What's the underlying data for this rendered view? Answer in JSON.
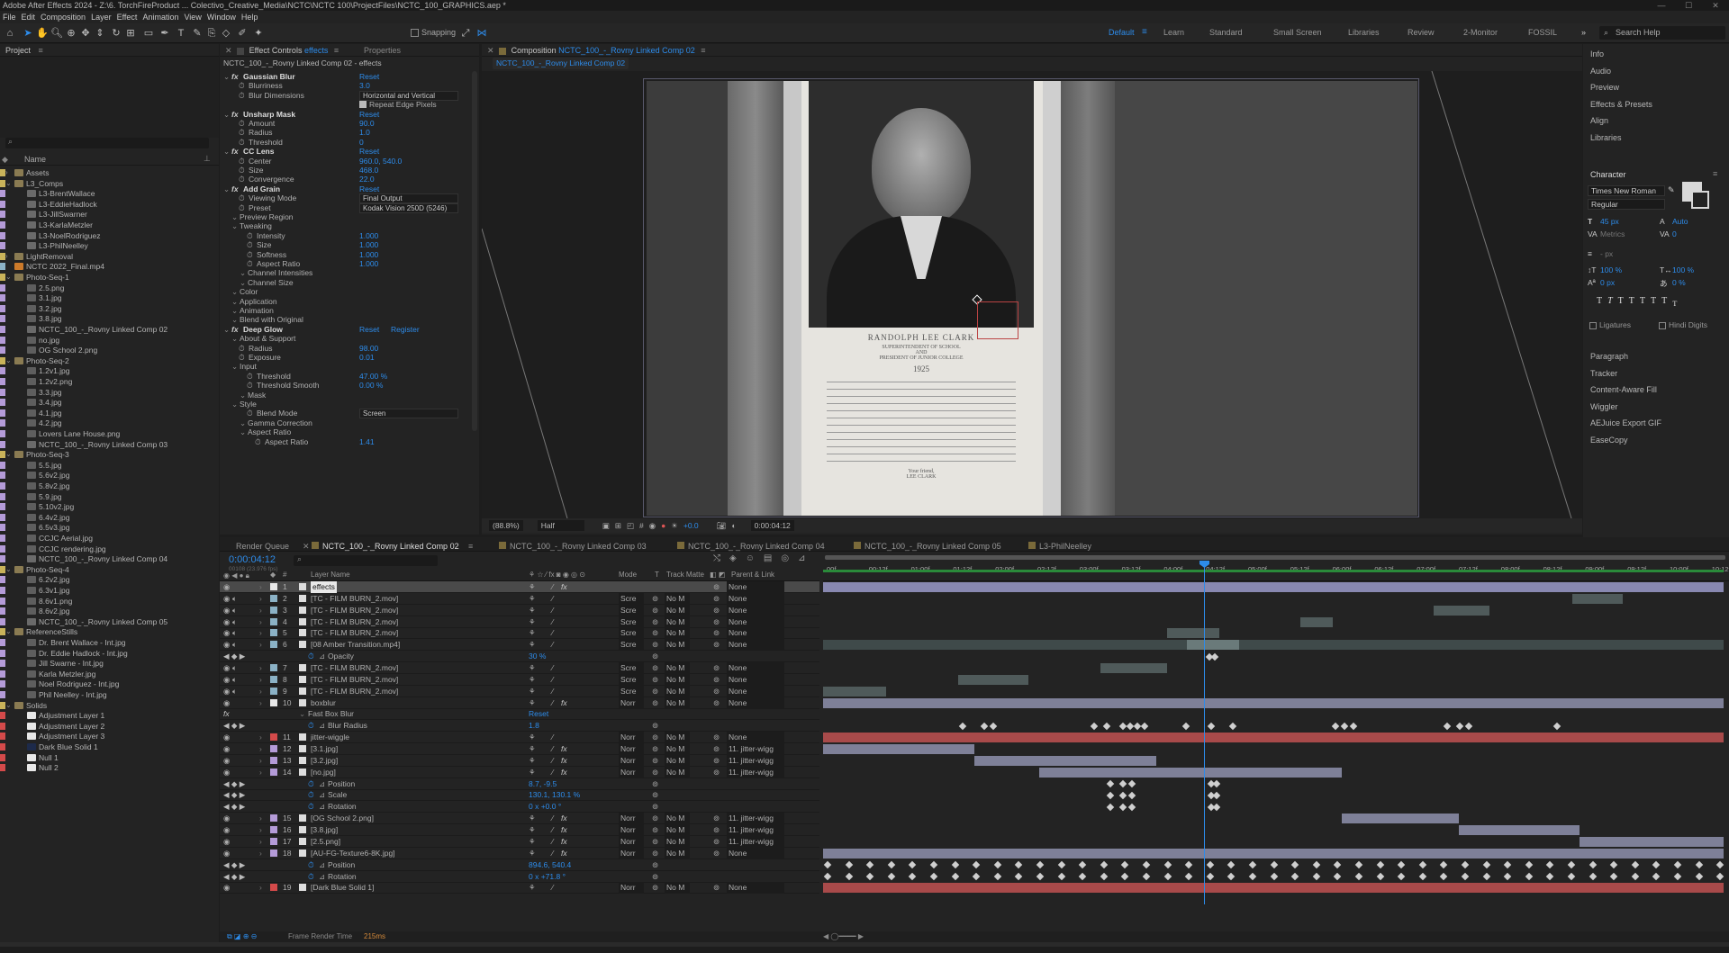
{
  "app": {
    "title": "Adobe After Effects 2024 - Z:\\6. TorchFireProduct ... Colectivo_Creative_Media\\NCTC\\NCTC 100\\ProjectFiles\\NCTC_100_GRAPHICS.aep *"
  },
  "menu": [
    "File",
    "Edit",
    "Composition",
    "Layer",
    "Effect",
    "Animation",
    "View",
    "Window",
    "Help"
  ],
  "toolbar": {
    "snapping": "Snapping",
    "workspaces": [
      "Default",
      "Learn",
      "Standard",
      "Small Screen",
      "Libraries",
      "Review",
      "2-Monitor",
      "FOSSIL"
    ],
    "search_help": "Search Help"
  },
  "project": {
    "title": "Project",
    "column_name": "Name",
    "rows": [
      {
        "name": "Assets",
        "type": "folder",
        "indent": 1,
        "label": "#c9b35a"
      },
      {
        "name": "L3_Comps",
        "type": "folder",
        "indent": 1,
        "open": true,
        "label": "#c9b35a"
      },
      {
        "name": "L3-BrentWallace",
        "type": "comp",
        "indent": 3,
        "label": "#b49bd8"
      },
      {
        "name": "L3-EddieHadlock",
        "type": "comp",
        "indent": 3,
        "label": "#b49bd8"
      },
      {
        "name": "L3-JillSwarner",
        "type": "comp",
        "indent": 3,
        "label": "#b49bd8"
      },
      {
        "name": "L3-KarlaMetzler",
        "type": "comp",
        "indent": 3,
        "label": "#b49bd8"
      },
      {
        "name": "L3-NoelRodriguez",
        "type": "comp",
        "indent": 3,
        "label": "#b49bd8"
      },
      {
        "name": "L3-PhilNeelley",
        "type": "comp",
        "indent": 3,
        "label": "#b49bd8"
      },
      {
        "name": "LightRemoval",
        "type": "folder",
        "indent": 1,
        "label": "#c9b35a"
      },
      {
        "name": "NCTC 2022_Final.mp4",
        "type": "video",
        "indent": 1,
        "label": "#8bb2c6"
      },
      {
        "name": "Photo-Seq-1",
        "type": "folder",
        "indent": 1,
        "open": true,
        "label": "#c9b35a"
      },
      {
        "name": "2.5.png",
        "type": "image",
        "indent": 3,
        "label": "#b49bd8"
      },
      {
        "name": "3.1.jpg",
        "type": "image",
        "indent": 3,
        "label": "#b49bd8"
      },
      {
        "name": "3.2.jpg",
        "type": "image",
        "indent": 3,
        "label": "#b49bd8"
      },
      {
        "name": "3.8.jpg",
        "type": "image",
        "indent": 3,
        "label": "#b49bd8"
      },
      {
        "name": "NCTC_100_-_Rovny Linked Comp 02",
        "type": "comp",
        "indent": 3,
        "label": "#b49bd8"
      },
      {
        "name": "no.jpg",
        "type": "image",
        "indent": 3,
        "label": "#b49bd8"
      },
      {
        "name": "OG School 2.png",
        "type": "image",
        "indent": 3,
        "label": "#b49bd8"
      },
      {
        "name": "Photo-Seq-2",
        "type": "folder",
        "indent": 1,
        "open": true,
        "label": "#c9b35a"
      },
      {
        "name": "1.2v1.jpg",
        "type": "image",
        "indent": 3,
        "label": "#b49bd8"
      },
      {
        "name": "1.2v2.png",
        "type": "image",
        "indent": 3,
        "label": "#b49bd8"
      },
      {
        "name": "3.3.jpg",
        "type": "image",
        "indent": 3,
        "label": "#b49bd8"
      },
      {
        "name": "3.4.jpg",
        "type": "image",
        "indent": 3,
        "label": "#b49bd8"
      },
      {
        "name": "4.1.jpg",
        "type": "image",
        "indent": 3,
        "label": "#b49bd8"
      },
      {
        "name": "4.2.jpg",
        "type": "image",
        "indent": 3,
        "label": "#b49bd8"
      },
      {
        "name": "Lovers Lane House.png",
        "type": "image",
        "indent": 3,
        "label": "#b49bd8"
      },
      {
        "name": "NCTC_100_-_Rovny Linked Comp 03",
        "type": "comp",
        "indent": 3,
        "label": "#b49bd8"
      },
      {
        "name": "Photo-Seq-3",
        "type": "folder",
        "indent": 1,
        "open": true,
        "label": "#c9b35a"
      },
      {
        "name": "5.5.jpg",
        "type": "image",
        "indent": 3,
        "label": "#b49bd8"
      },
      {
        "name": "5.6v2.jpg",
        "type": "image",
        "indent": 3,
        "label": "#b49bd8"
      },
      {
        "name": "5.8v2.jpg",
        "type": "image",
        "indent": 3,
        "label": "#b49bd8"
      },
      {
        "name": "5.9.jpg",
        "type": "image",
        "indent": 3,
        "label": "#b49bd8"
      },
      {
        "name": "5.10v2.jpg",
        "type": "image",
        "indent": 3,
        "label": "#b49bd8"
      },
      {
        "name": "6.4v2.jpg",
        "type": "image",
        "indent": 3,
        "label": "#b49bd8"
      },
      {
        "name": "6.5v3.jpg",
        "type": "image",
        "indent": 3,
        "label": "#b49bd8"
      },
      {
        "name": "CCJC Aerial.jpg",
        "type": "image",
        "indent": 3,
        "label": "#b49bd8"
      },
      {
        "name": "CCJC rendering.jpg",
        "type": "image",
        "indent": 3,
        "label": "#b49bd8"
      },
      {
        "name": "NCTC_100_-_Rovny Linked Comp 04",
        "type": "comp",
        "indent": 3,
        "label": "#b49bd8"
      },
      {
        "name": "Photo-Seq-4",
        "type": "folder",
        "indent": 1,
        "open": true,
        "label": "#c9b35a"
      },
      {
        "name": "6.2v2.jpg",
        "type": "image",
        "indent": 3,
        "label": "#b49bd8"
      },
      {
        "name": "6.3v1.jpg",
        "type": "image",
        "indent": 3,
        "label": "#b49bd8"
      },
      {
        "name": "8.6v1.png",
        "type": "image",
        "indent": 3,
        "label": "#b49bd8"
      },
      {
        "name": "8.6v2.jpg",
        "type": "image",
        "indent": 3,
        "label": "#b49bd8"
      },
      {
        "name": "NCTC_100_-_Rovny Linked Comp 05",
        "type": "comp",
        "indent": 3,
        "label": "#b49bd8"
      },
      {
        "name": "ReferenceStills",
        "type": "folder",
        "indent": 1,
        "open": true,
        "label": "#c9b35a"
      },
      {
        "name": "Dr. Brent Wallace - Int.jpg",
        "type": "image",
        "indent": 3,
        "label": "#b49bd8"
      },
      {
        "name": "Dr. Eddie Hadlock - Int.jpg",
        "type": "image",
        "indent": 3,
        "label": "#b49bd8"
      },
      {
        "name": "Jill Swarne - Int.jpg",
        "type": "image",
        "indent": 3,
        "label": "#b49bd8"
      },
      {
        "name": "Karla Metzler.jpg",
        "type": "image",
        "indent": 3,
        "label": "#b49bd8"
      },
      {
        "name": "Noel Rodriguez - Int.jpg",
        "type": "image",
        "indent": 3,
        "label": "#b49bd8"
      },
      {
        "name": "Phil Neelley - Int.jpg",
        "type": "image",
        "indent": 3,
        "label": "#b49bd8"
      },
      {
        "name": "Solids",
        "type": "folder",
        "indent": 1,
        "open": true,
        "label": "#c9b35a"
      },
      {
        "name": "Adjustment Layer 1",
        "type": "solid",
        "indent": 3,
        "label": "#d44a4a"
      },
      {
        "name": "Adjustment Layer 2",
        "type": "solid",
        "indent": 3,
        "label": "#d44a4a"
      },
      {
        "name": "Adjustment Layer 3",
        "type": "solid",
        "indent": 3,
        "label": "#d44a4a"
      },
      {
        "name": "Dark Blue Solid 1",
        "type": "solid-dark",
        "indent": 3,
        "label": "#d44a4a"
      },
      {
        "name": "Null 1",
        "type": "solid",
        "indent": 3,
        "label": "#d44a4a"
      },
      {
        "name": "Null 2",
        "type": "solid",
        "indent": 3,
        "label": "#d44a4a"
      }
    ]
  },
  "effect_controls": {
    "tab": "Effect Controls",
    "tab_target": "effects",
    "properties_tab": "Properties",
    "header": "NCTC_100_-_Rovny Linked Comp 02 - effects",
    "rows": [
      {
        "level": 0,
        "name": "Gaussian Blur",
        "fx": true,
        "value": "Reset"
      },
      {
        "level": 1,
        "name": "Blurriness",
        "value": "3.0"
      },
      {
        "level": 1,
        "name": "Blur Dimensions",
        "dropdown": "Horizontal and Vertical"
      },
      {
        "level": 1,
        "name": "",
        "checkbox": "Repeat Edge Pixels"
      },
      {
        "level": 0,
        "name": "Unsharp Mask",
        "fx": true,
        "value": "Reset"
      },
      {
        "level": 1,
        "name": "Amount",
        "value": "90.0"
      },
      {
        "level": 1,
        "name": "Radius",
        "value": "1.0"
      },
      {
        "level": 1,
        "name": "Threshold",
        "value": "0"
      },
      {
        "level": 0,
        "name": "CC Lens",
        "fx": true,
        "value": "Reset"
      },
      {
        "level": 1,
        "name": "Center",
        "value": "960.0, 540.0"
      },
      {
        "level": 1,
        "name": "Size",
        "value": "468.0"
      },
      {
        "level": 1,
        "name": "Convergence",
        "value": "22.0"
      },
      {
        "level": 0,
        "name": "Add Grain",
        "fx": true,
        "value": "Reset"
      },
      {
        "level": 1,
        "name": "Viewing Mode",
        "dropdown": "Final Output"
      },
      {
        "level": 1,
        "name": "Preset",
        "dropdown": "Kodak Vision 250D (5246)"
      },
      {
        "level": 1,
        "name": "Preview Region",
        "group": true
      },
      {
        "level": 1,
        "name": "Tweaking",
        "group": true
      },
      {
        "level": 2,
        "name": "Intensity",
        "value": "1.000"
      },
      {
        "level": 2,
        "name": "Size",
        "value": "1.000"
      },
      {
        "level": 2,
        "name": "Softness",
        "value": "1.000"
      },
      {
        "level": 2,
        "name": "Aspect Ratio",
        "value": "1.000"
      },
      {
        "level": 2,
        "name": "Channel Intensities",
        "group": true
      },
      {
        "level": 2,
        "name": "Channel Size",
        "group": true
      },
      {
        "level": 1,
        "name": "Color",
        "group": true
      },
      {
        "level": 1,
        "name": "Application",
        "group": true
      },
      {
        "level": 1,
        "name": "Animation",
        "group": true
      },
      {
        "level": 1,
        "name": "Blend with Original",
        "group": true
      },
      {
        "level": 0,
        "name": "Deep Glow",
        "fx": true,
        "value": "Reset",
        "value2": "Register"
      },
      {
        "level": 1,
        "name": "About & Support",
        "group": true
      },
      {
        "level": 1,
        "name": "Radius",
        "value": "98.00"
      },
      {
        "level": 1,
        "name": "Exposure",
        "value": "0.01"
      },
      {
        "level": 1,
        "name": "Input",
        "group": true
      },
      {
        "level": 2,
        "name": "Threshold",
        "value": "47.00 %"
      },
      {
        "level": 2,
        "name": "Threshold Smooth",
        "value": "0.00 %"
      },
      {
        "level": 2,
        "name": "Mask",
        "group": true
      },
      {
        "level": 1,
        "name": "Style",
        "group": true
      },
      {
        "level": 2,
        "name": "Blend Mode",
        "dropdown": "Screen"
      },
      {
        "level": 2,
        "name": "Gamma Correction",
        "group": true
      },
      {
        "level": 2,
        "name": "Aspect Ratio",
        "group": true
      },
      {
        "level": 3,
        "name": "Aspect Ratio",
        "value": "1.41"
      }
    ]
  },
  "composition": {
    "tab_prefix": "Composition",
    "tab": "NCTC_100_-_Rovny Linked Comp 02",
    "subtab": "NCTC_100_-_Rovny Linked Comp 02",
    "zoom": "(88.8%)",
    "resolution": "Half",
    "exposure": "+0.0",
    "timecode": "0:00:04:12",
    "photo_text": {
      "name": "RANDOLPH LEE CLARK",
      "line1": "SUPERINTENDENT OF SCHOOL",
      "line2": "AND",
      "line3": "PRESIDENT OF JUNIOR COLLEGE",
      "year": "1925",
      "sign": "Your friend,",
      "sign2": "LEE CLARK"
    }
  },
  "right_panel": {
    "items": [
      "Info",
      "Audio",
      "Preview",
      "Effects & Presets",
      "Align",
      "Libraries"
    ],
    "character": {
      "title": "Character",
      "font": "Times New Roman",
      "style": "Regular",
      "size": "45 px",
      "leading": "Auto",
      "kerning": "Metrics",
      "tracking": "0",
      "stroke": "- px",
      "vscale": "100 %",
      "hscale": "100 %",
      "baseline": "0 px",
      "tsume": "0 %",
      "ligatures": "Ligatures",
      "hindi": "Hindi Digits"
    },
    "items2": [
      "Paragraph",
      "Tracker",
      "Content-Aware Fill",
      "Wiggler",
      "AEJuice Export GIF",
      "EaseCopy"
    ]
  },
  "timeline": {
    "tabs": [
      "Render Queue",
      "NCTC_100_-_Rovny Linked Comp 02",
      "NCTC_100_-_Rovny Linked Comp 03",
      "NCTC_100_-_Rovny Linked Comp 04",
      "NCTC_100_-_Rovny Linked Comp 05",
      "L3-PhilNeelley"
    ],
    "timecode": "0:00:04:12",
    "timecode_sub": "00108 (23.976 fps)",
    "col_layer_name": "Layer Name",
    "col_mode": "Mode",
    "col_t": "T",
    "col_trkmat": "Track Matte",
    "col_parent": "Parent & Link",
    "ruler": [
      "00f",
      "00:12f",
      "01:00f",
      "01:12f",
      "02:00f",
      "02:12f",
      "03:00f",
      "03:12f",
      "04:00f",
      "04:12f",
      "05:00f",
      "05:12f",
      "06:00f",
      "06:12f",
      "07:00f",
      "07:12f",
      "08:00f",
      "08:12f",
      "09:00f",
      "09:12f",
      "10:00f",
      "10:12f"
    ],
    "rows": [
      {
        "kind": "layer",
        "num": "1",
        "name": "effects",
        "label": "#e8e8e8",
        "mode": "",
        "matte": "",
        "parent": "None",
        "fx": true,
        "selected": true
      },
      {
        "kind": "layer",
        "num": "2",
        "name": "[TC - FILM BURN_2.mov]",
        "label": "#8bb2c6",
        "mode": "Scre",
        "matte": "No M",
        "parent": "None"
      },
      {
        "kind": "layer",
        "num": "3",
        "name": "[TC - FILM BURN_2.mov]",
        "label": "#8bb2c6",
        "mode": "Scre",
        "matte": "No M",
        "parent": "None"
      },
      {
        "kind": "layer",
        "num": "4",
        "name": "[TC - FILM BURN_2.mov]",
        "label": "#8bb2c6",
        "mode": "Scre",
        "matte": "No M",
        "parent": "None"
      },
      {
        "kind": "layer",
        "num": "5",
        "name": "[TC - FILM BURN_2.mov]",
        "label": "#8bb2c6",
        "mode": "Scre",
        "matte": "No M",
        "parent": "None"
      },
      {
        "kind": "layer",
        "num": "6",
        "name": "[08 Amber Transition.mp4]",
        "label": "#8bb2c6",
        "mode": "Scre",
        "matte": "No M",
        "parent": "None"
      },
      {
        "kind": "prop",
        "name": "Opacity",
        "value": "30 %"
      },
      {
        "kind": "layer",
        "num": "7",
        "name": "[TC - FILM BURN_2.mov]",
        "label": "#8bb2c6",
        "mode": "Scre",
        "matte": "No M",
        "parent": "None"
      },
      {
        "kind": "layer",
        "num": "8",
        "name": "[TC - FILM BURN_2.mov]",
        "label": "#8bb2c6",
        "mode": "Scre",
        "matte": "No M",
        "parent": "None"
      },
      {
        "kind": "layer",
        "num": "9",
        "name": "[TC - FILM BURN_2.mov]",
        "label": "#8bb2c6",
        "mode": "Scre",
        "matte": "No M",
        "parent": "None"
      },
      {
        "kind": "layer",
        "num": "10",
        "name": "boxblur",
        "label": "#e8e8e8",
        "mode": "Norr",
        "matte": "No M",
        "parent": "None",
        "fx": true
      },
      {
        "kind": "effect",
        "name": "Fast Box Blur",
        "value": "Reset"
      },
      {
        "kind": "prop",
        "name": "Blur Radius",
        "value": "1.8"
      },
      {
        "kind": "layer",
        "num": "11",
        "name": "jitter-wiggle",
        "label": "#d44a4a",
        "mode": "Norr",
        "matte": "No M",
        "parent": "None"
      },
      {
        "kind": "layer",
        "num": "12",
        "name": "[3.1.jpg]",
        "label": "#b49bd8",
        "mode": "Norr",
        "matte": "No M",
        "parent": "11. jitter-wigg",
        "fx": true
      },
      {
        "kind": "layer",
        "num": "13",
        "name": "[3.2.jpg]",
        "label": "#b49bd8",
        "mode": "Norr",
        "matte": "No M",
        "parent": "11. jitter-wigg",
        "fx": true
      },
      {
        "kind": "layer",
        "num": "14",
        "name": "[no.jpg]",
        "label": "#b49bd8",
        "mode": "Norr",
        "matte": "No M",
        "parent": "11. jitter-wigg",
        "fx": true
      },
      {
        "kind": "prop",
        "name": "Position",
        "value": "8.7, -9.5"
      },
      {
        "kind": "prop",
        "name": "Scale",
        "value": "130.1, 130.1 %"
      },
      {
        "kind": "prop",
        "name": "Rotation",
        "value": "0 x +0.0 °"
      },
      {
        "kind": "layer",
        "num": "15",
        "name": "[OG School 2.png]",
        "label": "#b49bd8",
        "mode": "Norr",
        "matte": "No M",
        "parent": "11. jitter-wigg",
        "fx": true
      },
      {
        "kind": "layer",
        "num": "16",
        "name": "[3.8.jpg]",
        "label": "#b49bd8",
        "mode": "Norr",
        "matte": "No M",
        "parent": "11. jitter-wigg",
        "fx": true
      },
      {
        "kind": "layer",
        "num": "17",
        "name": "[2.5.png]",
        "label": "#b49bd8",
        "mode": "Norr",
        "matte": "No M",
        "parent": "11. jitter-wigg",
        "fx": true
      },
      {
        "kind": "layer",
        "num": "18",
        "name": "[AU-FG-Texture6-8K.jpg]",
        "label": "#b49bd8",
        "mode": "Norr",
        "matte": "No M",
        "parent": "None",
        "fx": true
      },
      {
        "kind": "prop",
        "name": "Position",
        "value": "894.6, 540.4"
      },
      {
        "kind": "prop",
        "name": "Rotation",
        "value": "0 x +71.8 °"
      },
      {
        "kind": "layer",
        "num": "19",
        "name": "[Dark Blue Solid 1]",
        "label": "#d44a4a",
        "mode": "Norr",
        "matte": "No M",
        "parent": "None"
      }
    ],
    "bottom": {
      "label": "Frame Render Time",
      "value": "215ms"
    }
  },
  "colors": {
    "accent": "#2d8ceb",
    "panel": "#232323",
    "bg": "#1d1d1d"
  }
}
